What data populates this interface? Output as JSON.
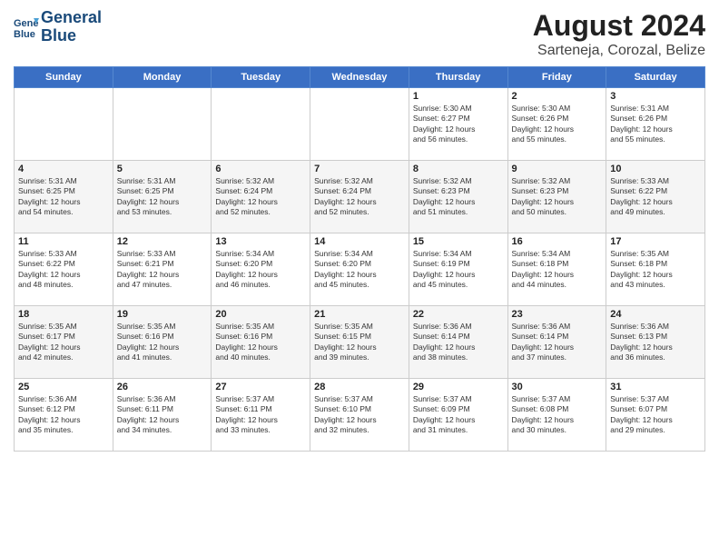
{
  "header": {
    "logo_line1": "General",
    "logo_line2": "Blue",
    "title": "August 2024",
    "subtitle": "Sarteneja, Corozal, Belize"
  },
  "days_of_week": [
    "Sunday",
    "Monday",
    "Tuesday",
    "Wednesday",
    "Thursday",
    "Friday",
    "Saturday"
  ],
  "weeks": [
    [
      {
        "day": "",
        "info": ""
      },
      {
        "day": "",
        "info": ""
      },
      {
        "day": "",
        "info": ""
      },
      {
        "day": "",
        "info": ""
      },
      {
        "day": "1",
        "info": "Sunrise: 5:30 AM\nSunset: 6:27 PM\nDaylight: 12 hours\nand 56 minutes."
      },
      {
        "day": "2",
        "info": "Sunrise: 5:30 AM\nSunset: 6:26 PM\nDaylight: 12 hours\nand 55 minutes."
      },
      {
        "day": "3",
        "info": "Sunrise: 5:31 AM\nSunset: 6:26 PM\nDaylight: 12 hours\nand 55 minutes."
      }
    ],
    [
      {
        "day": "4",
        "info": "Sunrise: 5:31 AM\nSunset: 6:25 PM\nDaylight: 12 hours\nand 54 minutes."
      },
      {
        "day": "5",
        "info": "Sunrise: 5:31 AM\nSunset: 6:25 PM\nDaylight: 12 hours\nand 53 minutes."
      },
      {
        "day": "6",
        "info": "Sunrise: 5:32 AM\nSunset: 6:24 PM\nDaylight: 12 hours\nand 52 minutes."
      },
      {
        "day": "7",
        "info": "Sunrise: 5:32 AM\nSunset: 6:24 PM\nDaylight: 12 hours\nand 52 minutes."
      },
      {
        "day": "8",
        "info": "Sunrise: 5:32 AM\nSunset: 6:23 PM\nDaylight: 12 hours\nand 51 minutes."
      },
      {
        "day": "9",
        "info": "Sunrise: 5:32 AM\nSunset: 6:23 PM\nDaylight: 12 hours\nand 50 minutes."
      },
      {
        "day": "10",
        "info": "Sunrise: 5:33 AM\nSunset: 6:22 PM\nDaylight: 12 hours\nand 49 minutes."
      }
    ],
    [
      {
        "day": "11",
        "info": "Sunrise: 5:33 AM\nSunset: 6:22 PM\nDaylight: 12 hours\nand 48 minutes."
      },
      {
        "day": "12",
        "info": "Sunrise: 5:33 AM\nSunset: 6:21 PM\nDaylight: 12 hours\nand 47 minutes."
      },
      {
        "day": "13",
        "info": "Sunrise: 5:34 AM\nSunset: 6:20 PM\nDaylight: 12 hours\nand 46 minutes."
      },
      {
        "day": "14",
        "info": "Sunrise: 5:34 AM\nSunset: 6:20 PM\nDaylight: 12 hours\nand 45 minutes."
      },
      {
        "day": "15",
        "info": "Sunrise: 5:34 AM\nSunset: 6:19 PM\nDaylight: 12 hours\nand 45 minutes."
      },
      {
        "day": "16",
        "info": "Sunrise: 5:34 AM\nSunset: 6:18 PM\nDaylight: 12 hours\nand 44 minutes."
      },
      {
        "day": "17",
        "info": "Sunrise: 5:35 AM\nSunset: 6:18 PM\nDaylight: 12 hours\nand 43 minutes."
      }
    ],
    [
      {
        "day": "18",
        "info": "Sunrise: 5:35 AM\nSunset: 6:17 PM\nDaylight: 12 hours\nand 42 minutes."
      },
      {
        "day": "19",
        "info": "Sunrise: 5:35 AM\nSunset: 6:16 PM\nDaylight: 12 hours\nand 41 minutes."
      },
      {
        "day": "20",
        "info": "Sunrise: 5:35 AM\nSunset: 6:16 PM\nDaylight: 12 hours\nand 40 minutes."
      },
      {
        "day": "21",
        "info": "Sunrise: 5:35 AM\nSunset: 6:15 PM\nDaylight: 12 hours\nand 39 minutes."
      },
      {
        "day": "22",
        "info": "Sunrise: 5:36 AM\nSunset: 6:14 PM\nDaylight: 12 hours\nand 38 minutes."
      },
      {
        "day": "23",
        "info": "Sunrise: 5:36 AM\nSunset: 6:14 PM\nDaylight: 12 hours\nand 37 minutes."
      },
      {
        "day": "24",
        "info": "Sunrise: 5:36 AM\nSunset: 6:13 PM\nDaylight: 12 hours\nand 36 minutes."
      }
    ],
    [
      {
        "day": "25",
        "info": "Sunrise: 5:36 AM\nSunset: 6:12 PM\nDaylight: 12 hours\nand 35 minutes."
      },
      {
        "day": "26",
        "info": "Sunrise: 5:36 AM\nSunset: 6:11 PM\nDaylight: 12 hours\nand 34 minutes."
      },
      {
        "day": "27",
        "info": "Sunrise: 5:37 AM\nSunset: 6:11 PM\nDaylight: 12 hours\nand 33 minutes."
      },
      {
        "day": "28",
        "info": "Sunrise: 5:37 AM\nSunset: 6:10 PM\nDaylight: 12 hours\nand 32 minutes."
      },
      {
        "day": "29",
        "info": "Sunrise: 5:37 AM\nSunset: 6:09 PM\nDaylight: 12 hours\nand 31 minutes."
      },
      {
        "day": "30",
        "info": "Sunrise: 5:37 AM\nSunset: 6:08 PM\nDaylight: 12 hours\nand 30 minutes."
      },
      {
        "day": "31",
        "info": "Sunrise: 5:37 AM\nSunset: 6:07 PM\nDaylight: 12 hours\nand 29 minutes."
      }
    ]
  ]
}
